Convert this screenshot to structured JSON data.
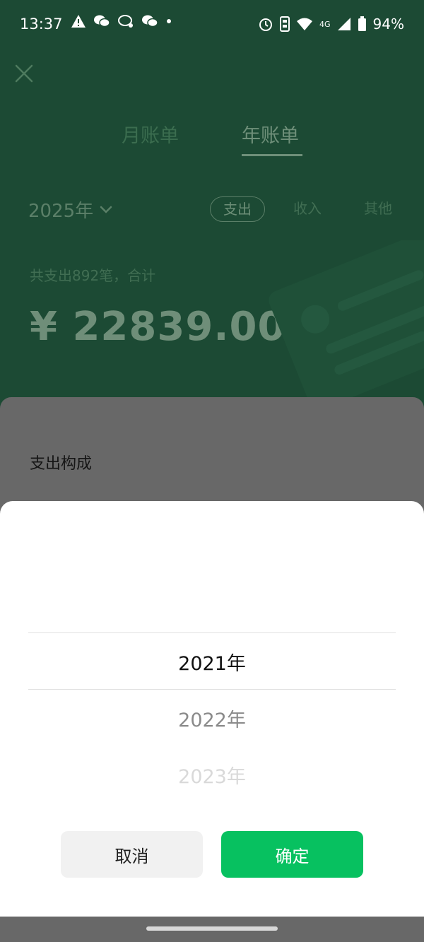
{
  "status_bar": {
    "time": "13:37",
    "left_icons": [
      "warning-icon",
      "wechat-icon",
      "chat-bubble-icon",
      "wechat-icon",
      "dot-icon"
    ],
    "network": "4G",
    "battery": "94%"
  },
  "header": {
    "tabs": [
      {
        "label": "月账单"
      },
      {
        "label": "年账单"
      }
    ],
    "selected_year": "2025年",
    "filters": [
      "支出",
      "收入",
      "其他"
    ],
    "summary_caption": "共支出892笔，合计",
    "summary_amount": "¥ 22839.00"
  },
  "section_title": "支出构成",
  "picker": {
    "options": [
      "2021年",
      "2022年",
      "2023年"
    ],
    "selected_index": 0,
    "cancel_label": "取消",
    "confirm_label": "确定"
  },
  "colors": {
    "header_bg": "#1c4a34",
    "accent_green": "#07c160",
    "overlay_gray": "#686868"
  }
}
